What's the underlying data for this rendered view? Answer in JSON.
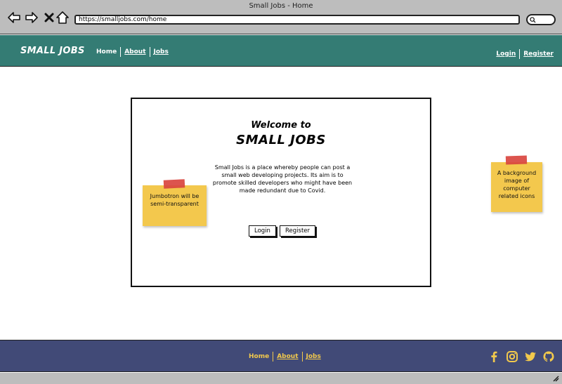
{
  "window": {
    "title": "Small Jobs - Home",
    "url": "https://smalljobs.com/home"
  },
  "browser_icons": [
    "back-arrow-icon",
    "forward-arrow-icon",
    "close-icon",
    "home-icon",
    "search-icon"
  ],
  "header": {
    "brand": "SMALL JOBS",
    "nav": [
      {
        "label": "Home",
        "active": true
      },
      {
        "label": "About",
        "active": false
      },
      {
        "label": "Jobs",
        "active": false
      }
    ],
    "auth": [
      {
        "label": "Login"
      },
      {
        "label": "Register"
      }
    ]
  },
  "jumbotron": {
    "welcome": "Welcome to",
    "title": "SMALL JOBS",
    "intro": "Small Jobs is a place whereby people can post a small web developing projects. Its aim is to promote skilled developers who might have been made redundant due to Covid.",
    "login_label": "Login",
    "register_label": "Register"
  },
  "notes": {
    "left": "Jumbotron will be semi-transparent",
    "right": "A background image of computer related icons"
  },
  "footer": {
    "nav": [
      {
        "label": "Home",
        "active": true
      },
      {
        "label": "About",
        "active": false
      },
      {
        "label": "Jobs",
        "active": false
      }
    ],
    "social_icons": [
      "facebook-icon",
      "instagram-icon",
      "twitter-icon",
      "github-icon"
    ]
  },
  "colors": {
    "header_bg": "#347c74",
    "footer_bg": "#414a77",
    "footer_text": "#f2c94c",
    "note_yellow": "#f3c84d",
    "tape_red": "#d9453f",
    "chrome_gray": "#bdbdbd"
  }
}
